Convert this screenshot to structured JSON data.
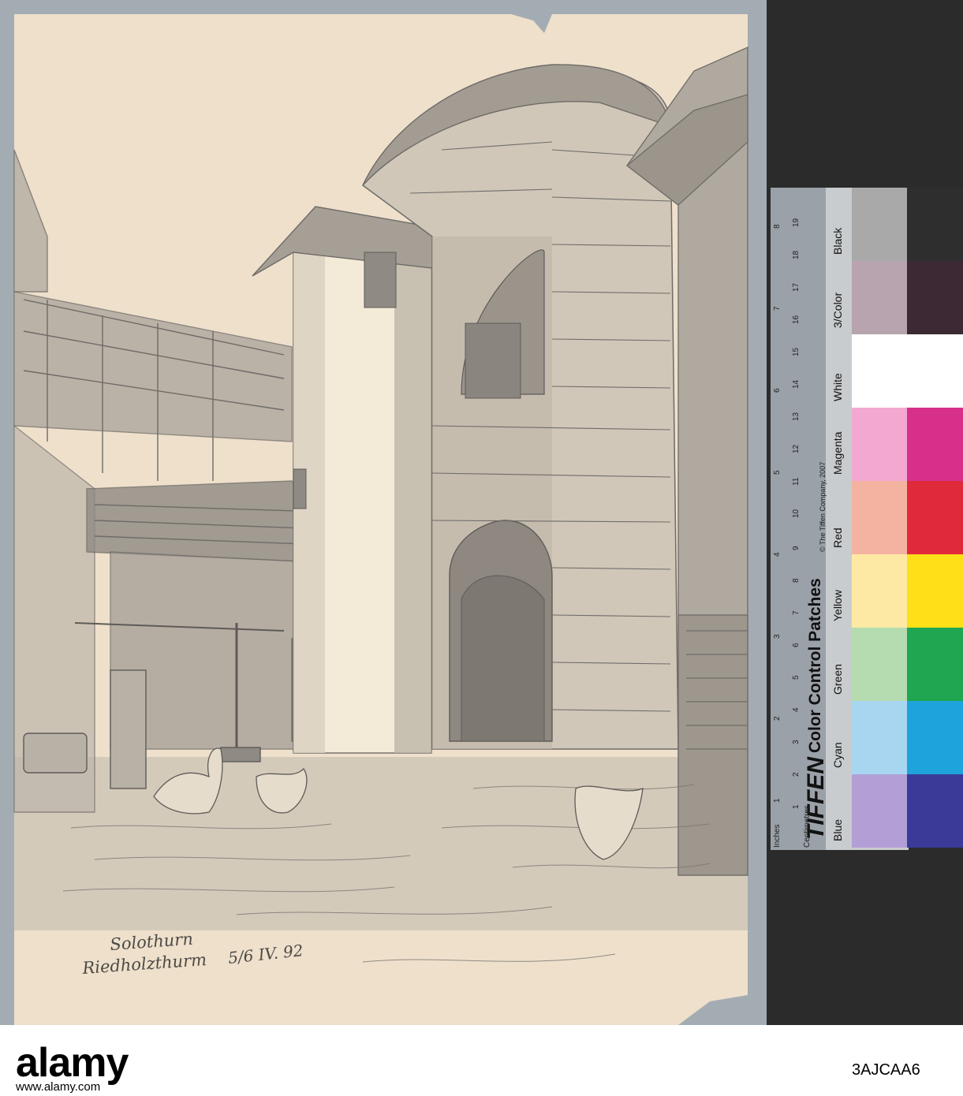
{
  "inscription": {
    "line1": "Solothurn",
    "line2": "Riedholzthurm",
    "date": "5/6 IV. 92"
  },
  "color_target": {
    "brand": "TIFFEN",
    "title": "Color Control Patches",
    "copyright": "© The Tiffen Company, 2007",
    "ruler_inches_label": "Inches",
    "ruler_cm_label": "Centimetres",
    "inch_ticks": [
      "1",
      "2",
      "3",
      "4",
      "5",
      "6",
      "7",
      "8"
    ],
    "cm_ticks": [
      "1",
      "2",
      "3",
      "4",
      "5",
      "6",
      "7",
      "8",
      "9",
      "10",
      "11",
      "12",
      "13",
      "14",
      "15",
      "16",
      "17",
      "18",
      "19"
    ],
    "patches": [
      {
        "name": "Blue",
        "light": "#b39fd6",
        "dark": "#3b3a98"
      },
      {
        "name": "Cyan",
        "light": "#a8d6f0",
        "dark": "#1ea3dc"
      },
      {
        "name": "Green",
        "light": "#b4dcb0",
        "dark": "#20a550"
      },
      {
        "name": "Yellow",
        "light": "#fde9a4",
        "dark": "#fde018"
      },
      {
        "name": "Red",
        "light": "#f4b3a1",
        "dark": "#e02a3a"
      },
      {
        "name": "Magenta",
        "light": "#f2a8d0",
        "dark": "#d6308a"
      },
      {
        "name": "White",
        "light": "#ffffff",
        "dark": "#ffffff"
      },
      {
        "name": "3/Color",
        "light": "#b7a4ae",
        "dark": "#3d2933"
      },
      {
        "name": "Black",
        "light": "#a9a9a9",
        "dark": "#2e2e2e"
      }
    ]
  },
  "watermark": {
    "logo": "alamy",
    "image_id": "3AJCAA6",
    "url": "www.alamy.com"
  },
  "colors": {
    "mount": "#a4acb3",
    "paper": "#eee0cb",
    "pencil": "#6e6b68",
    "wash": "#a9a39a"
  }
}
